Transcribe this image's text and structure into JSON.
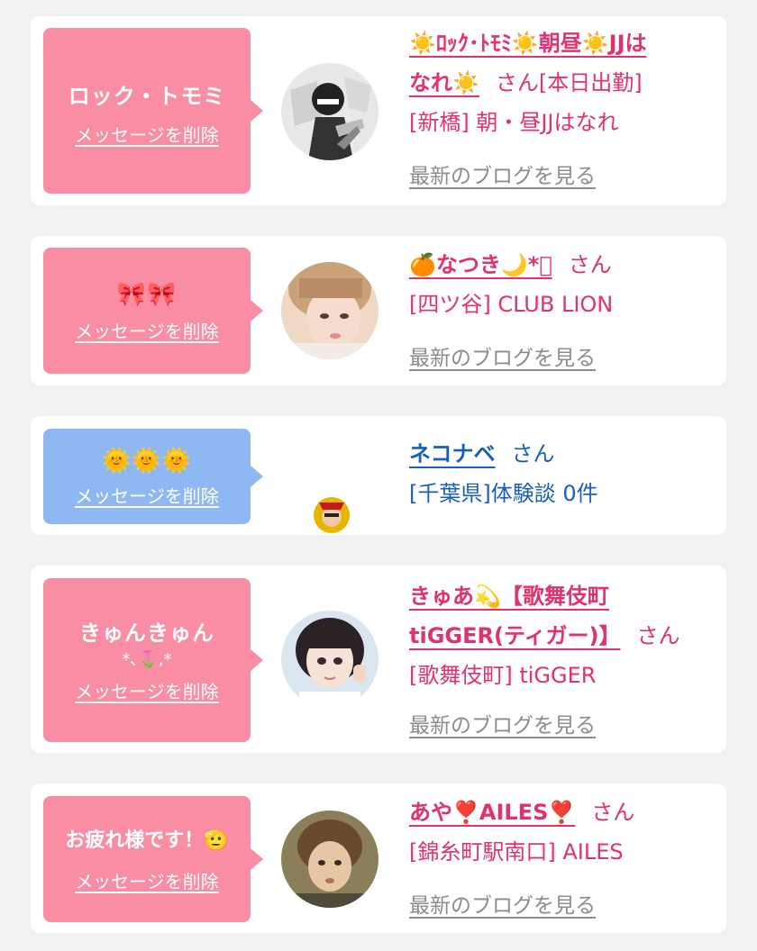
{
  "colors": {
    "pink_bubble": "#f88da3",
    "blue_bubble": "#8fb8f2",
    "pink_text": "#e0326e",
    "blue_text": "#1b5fb5",
    "link_gray": "#8c8c8c"
  },
  "common": {
    "delete_label": "メッセージを削除",
    "san": "さん",
    "blog_label": "最新のブログを見る"
  },
  "cards": [
    {
      "message": "ロック・トモミ",
      "name_line1": "☀️ﾛｯｸ･ﾄﾓﾐ☀️朝昼☀️JJは",
      "name_line2": "なれ☀️",
      "desc": "[本日出勤]",
      "shop": "[新橋] 朝・昼JJはなれ",
      "avatar_icon": "manga-avatar"
    },
    {
      "message": "🎀🎀",
      "name": "🍊なつき🌙*ﾟ",
      "shop": "[四ツ谷] CLUB LION",
      "avatar_icon": "girl-photo-avatar"
    },
    {
      "message": "🌞🌞🌞",
      "name": "ネコナベ",
      "shop": "[千葉県]体験談 0件",
      "avatar_icon": "small-user-avatar"
    },
    {
      "message": "きゅんきゅん",
      "message_sub": "*､🌷,*",
      "name_line1": "きゅあ💫【歌舞伎町",
      "name_line2": "tiGGER(ティガー)】",
      "shop": "[歌舞伎町] tiGGER",
      "avatar_icon": "idol-photo-avatar"
    },
    {
      "message": "お疲れ様です！🫡",
      "name": "あや❣️AILES❣️",
      "shop": "[錦糸町駅南口] AILES",
      "avatar_icon": "woman-photo-avatar"
    }
  ]
}
